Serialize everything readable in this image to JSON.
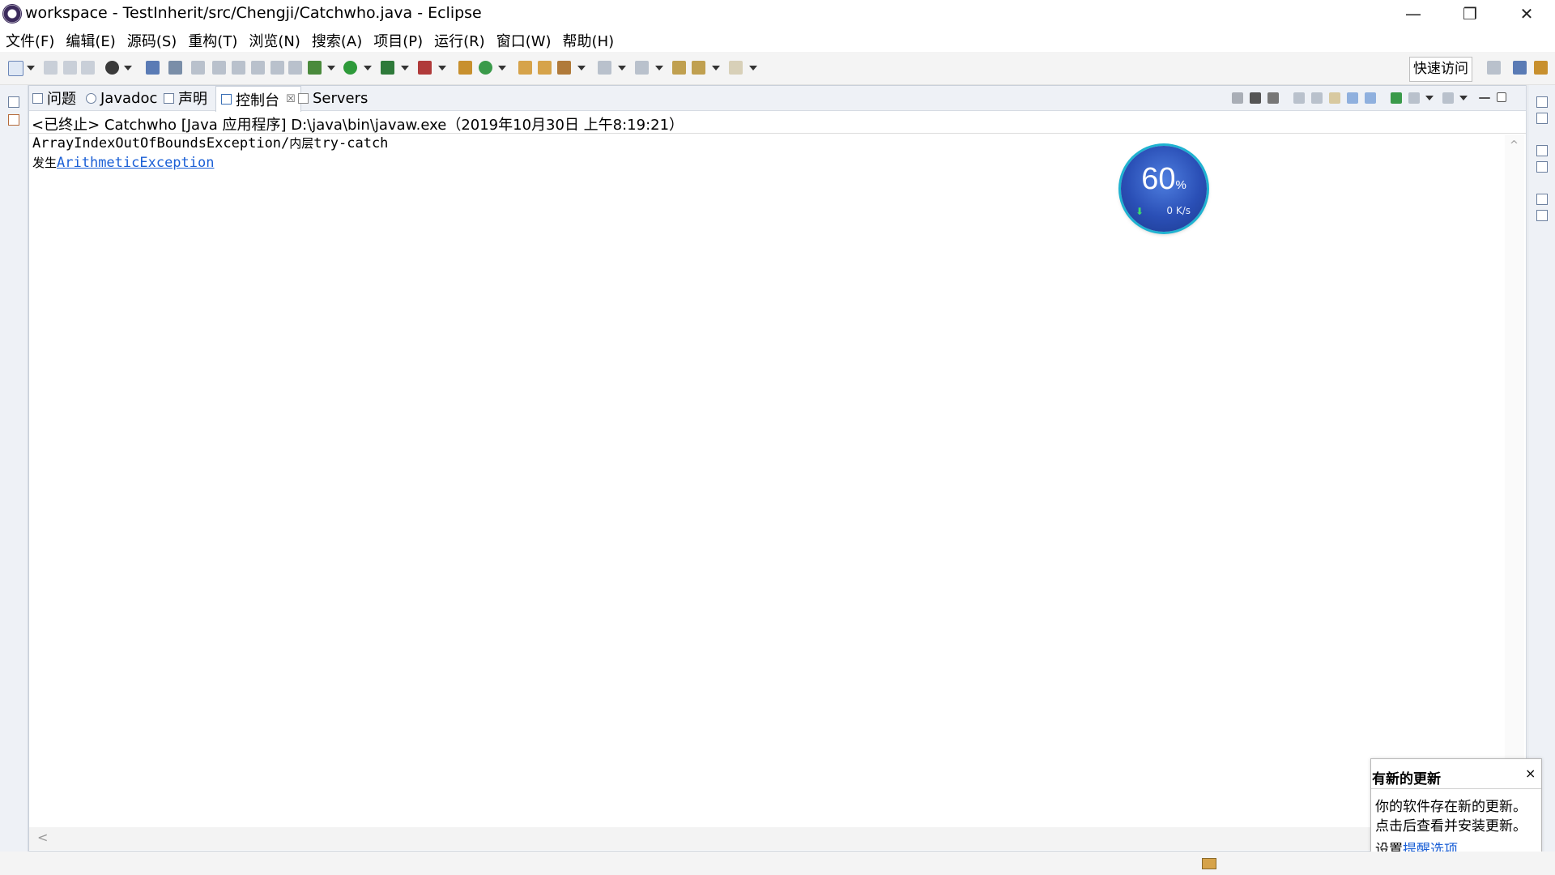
{
  "window": {
    "title": "workspace - TestInherit/src/Chengji/Catchwho.java - Eclipse",
    "minimize": "—",
    "maximize": "❐",
    "close": "✕"
  },
  "menu": [
    "文件(F)",
    "编辑(E)",
    "源码(S)",
    "重构(T)",
    "浏览(N)",
    "搜索(A)",
    "项目(P)",
    "运行(R)",
    "窗口(W)",
    "帮助(H)"
  ],
  "toolbar": {
    "quick_access": "快速访问"
  },
  "view": {
    "tabs": [
      {
        "label": "问题",
        "icon": "problems-icon"
      },
      {
        "label": "Javadoc",
        "icon": "javadoc-icon"
      },
      {
        "label": "声明",
        "icon": "declaration-icon"
      },
      {
        "label": "控制台",
        "icon": "console-icon",
        "active": true,
        "close": "☒"
      },
      {
        "label": "Servers",
        "icon": "servers-icon"
      }
    ],
    "console_header": "<已终止> Catchwho [Java 应用程序] D:\\java\\bin\\javaw.exe（2019年10月30日 上午8:19:21）",
    "output": {
      "line1_a": "ArrayIndexOutOfBoundsException/",
      "line1_b": "内层",
      "line1_c": "try-catch",
      "line2_a": "发生",
      "line2_link": "ArithmeticException"
    },
    "scroll_left": "<",
    "scroll_up": "^"
  },
  "gauge": {
    "percent": "60",
    "unit": "%",
    "speed": "0 K/s",
    "arrow": "⬇"
  },
  "notification": {
    "title": "有新的更新",
    "close": "×",
    "line1": "你的软件存在新的更新。",
    "line2": "点击后查看并安装更新。",
    "settings_prefix": "设置",
    "settings_link": "提醒选项"
  },
  "colors": {
    "link": "#1a5fd6",
    "trim": "#eef1f6",
    "gauge": "#2a4fb6",
    "gauge_ring": "#1fb3d1"
  }
}
